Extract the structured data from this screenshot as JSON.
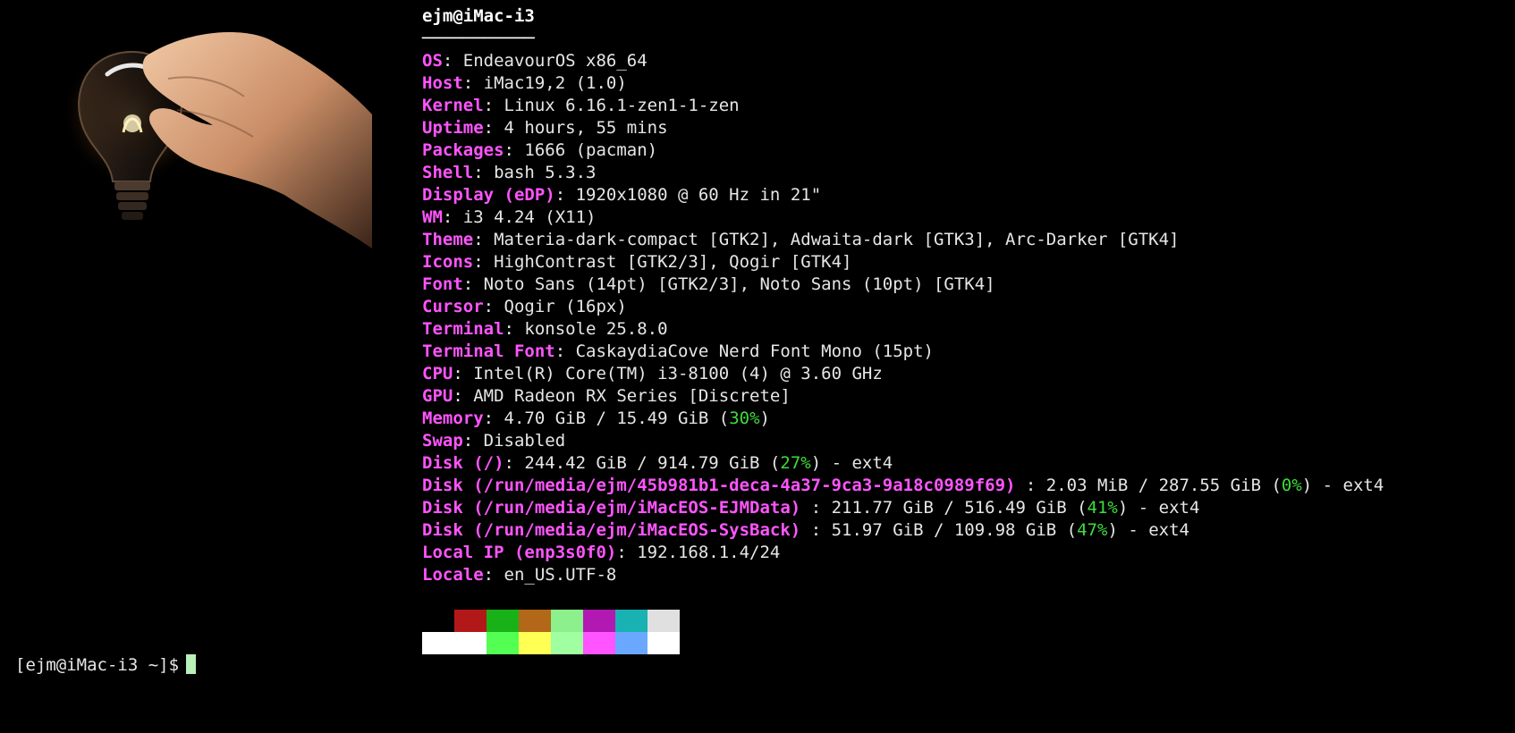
{
  "terminal": {
    "title": "ejm@iMac-i3",
    "separator": "───────────",
    "logo_icon": "lightbulb-in-hand-image",
    "rows": [
      {
        "key": "OS",
        "parts": [
          {
            "text": ": EndeavourOS x86_64"
          }
        ]
      },
      {
        "key": "Host",
        "parts": [
          {
            "text": ": iMac19,2 (1.0)"
          }
        ]
      },
      {
        "key": "Kernel",
        "parts": [
          {
            "text": ": Linux 6.16.1-zen1-1-zen"
          }
        ]
      },
      {
        "key": "Uptime",
        "parts": [
          {
            "text": ": 4 hours, 55 mins"
          }
        ]
      },
      {
        "key": "Packages",
        "parts": [
          {
            "text": ": 1666 (pacman)"
          }
        ]
      },
      {
        "key": "Shell",
        "parts": [
          {
            "text": ": bash 5.3.3"
          }
        ]
      },
      {
        "key": "Display (eDP)",
        "parts": [
          {
            "text": ": 1920x1080 @ 60 Hz in 21\""
          }
        ]
      },
      {
        "key": "WM",
        "parts": [
          {
            "text": ": i3 4.24 (X11)"
          }
        ]
      },
      {
        "key": "Theme",
        "parts": [
          {
            "text": ": Materia-dark-compact [GTK2], Adwaita-dark [GTK3], Arc-Darker [GTK4]"
          }
        ]
      },
      {
        "key": "Icons",
        "parts": [
          {
            "text": ": HighContrast [GTK2/3], Qogir [GTK4]"
          }
        ]
      },
      {
        "key": "Font",
        "parts": [
          {
            "text": ": Noto Sans (14pt) [GTK2/3], Noto Sans (10pt) [GTK4]"
          }
        ]
      },
      {
        "key": "Cursor",
        "parts": [
          {
            "text": ": Qogir (16px)"
          }
        ]
      },
      {
        "key": "Terminal",
        "parts": [
          {
            "text": ": konsole 25.8.0"
          }
        ]
      },
      {
        "key": "Terminal Font",
        "parts": [
          {
            "text": ": CaskaydiaCove Nerd Font Mono (15pt)"
          }
        ]
      },
      {
        "key": "CPU",
        "parts": [
          {
            "text": ": Intel(R) Core(TM) i3-8100 (4) @ 3.60 GHz"
          }
        ]
      },
      {
        "key": "GPU",
        "parts": [
          {
            "text": ": AMD Radeon RX Series [Discrete]"
          }
        ]
      },
      {
        "key": "Memory",
        "parts": [
          {
            "text": ": 4.70 GiB / 15.49 GiB ("
          },
          {
            "text": "30%",
            "pct": true
          },
          {
            "text": ")"
          }
        ]
      },
      {
        "key": "Swap",
        "parts": [
          {
            "text": ": Disabled"
          }
        ]
      },
      {
        "key": "Disk (/)",
        "parts": [
          {
            "text": ": 244.42 GiB / 914.79 GiB ("
          },
          {
            "text": "27%",
            "pct": true
          },
          {
            "text": ") - ext4"
          }
        ]
      },
      {
        "key": "Disk (/run/media/ejm/45b981b1-deca-4a37-9ca3-9a18c0989f69)",
        "parts": [
          {
            "text": " : 2.03 MiB / 287.55 GiB ("
          },
          {
            "text": "0%",
            "pct": true
          },
          {
            "text": ") - ext4"
          }
        ]
      },
      {
        "key": "Disk (/run/media/ejm/iMacEOS-EJMData)",
        "parts": [
          {
            "text": " : 211.77 GiB / 516.49 GiB ("
          },
          {
            "text": "41%",
            "pct": true
          },
          {
            "text": ") - ext4"
          }
        ]
      },
      {
        "key": "Disk (/run/media/ejm/iMacEOS-SysBack)",
        "parts": [
          {
            "text": " : 51.97 GiB / 109.98 GiB ("
          },
          {
            "text": "47%",
            "pct": true
          },
          {
            "text": ") - ext4"
          }
        ]
      },
      {
        "key": "Local IP (enp3s0f0)",
        "parts": [
          {
            "text": ": 192.168.1.4/24"
          }
        ]
      },
      {
        "key": "Locale",
        "parts": [
          {
            "text": ": en_US.UTF-8"
          }
        ]
      }
    ],
    "palette": {
      "row1": [
        "#000000",
        "#b21818",
        "#18b218",
        "#b26818",
        "#8cf08c",
        "#b218b2",
        "#18b2b2",
        "#e0e0e0"
      ],
      "row2": [
        "#ffffff",
        "#ffffff",
        "#54ff54",
        "#ffff54",
        "#a0ffa0",
        "#ff54ff",
        "#6aa8ff",
        "#ffffff"
      ]
    },
    "prompt": "[ejm@iMac-i3 ~]$"
  }
}
